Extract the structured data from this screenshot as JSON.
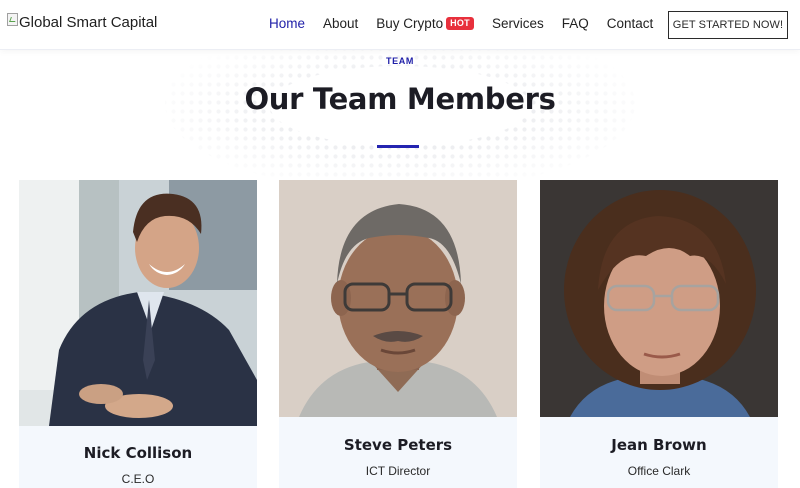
{
  "header": {
    "logo_alt": "Global Smart Capital",
    "nav": [
      {
        "label": "Home",
        "active": true
      },
      {
        "label": "About"
      },
      {
        "label": "Buy Crypto",
        "badge": "HOT"
      },
      {
        "label": "Services"
      },
      {
        "label": "FAQ"
      },
      {
        "label": "Contact"
      }
    ],
    "cta_label": "GET STARTED NOW!"
  },
  "section": {
    "eyebrow": "TEAM",
    "title": "Our Team Members"
  },
  "team": [
    {
      "name": "Nick Collison",
      "role": "C.E.O"
    },
    {
      "name": "Steve Peters",
      "role": "ICT Director"
    },
    {
      "name": "Jean Brown",
      "role": "Office Clark"
    }
  ],
  "colors": {
    "accent": "#1f1fa8",
    "hot_badge": "#e8303c",
    "card_bg": "#f4f8fd",
    "title": "#1c1c24"
  },
  "icons": {
    "logo": "broken-image-icon"
  }
}
